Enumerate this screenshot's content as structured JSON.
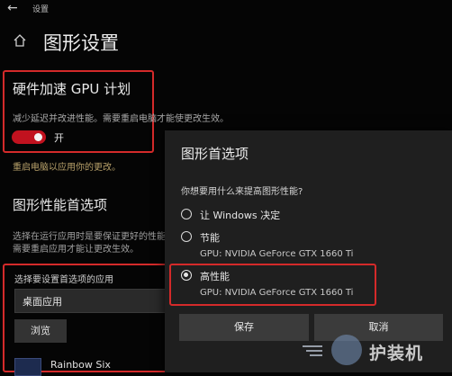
{
  "titlebar": {
    "back": "←",
    "title": "设置"
  },
  "header": {
    "title": "图形设置"
  },
  "hardware_gpu": {
    "title": "硬件加速 GPU 计划",
    "description": "减少延迟并改进性能。需要重启电脑才能使更改生效。",
    "toggle_label": "开",
    "toggle_on": true,
    "restart_note": "重启电脑以应用你的更改。"
  },
  "graphics_performance": {
    "title": "图形性能首选项",
    "desc_line1": "选择在运行应用时是要保证更好的性能还是节省电池电量。",
    "desc_line2": "需要重启应用才能让更改生效。",
    "choose_label": "选择要设置首选项的应用",
    "app_type_selected": "桌面应用",
    "browse_label": "浏览",
    "app_name": "Rainbow Six"
  },
  "dialog": {
    "title": "图形首选项",
    "question": "你想要用什么来提高图形性能?",
    "options": [
      {
        "label": "让 Windows 决定",
        "gpu": "",
        "selected": false
      },
      {
        "label": "节能",
        "gpu": "GPU: NVIDIA GeForce GTX 1660 Ti",
        "selected": false
      },
      {
        "label": "高性能",
        "gpu": "GPU: NVIDIA GeForce GTX 1660 Ti",
        "selected": true
      }
    ],
    "save_label": "保存",
    "cancel_label": "取消"
  },
  "watermark": {
    "text": "护装机"
  },
  "colors": {
    "accent": "#c1121f",
    "highlight_box": "#d42a2a",
    "background": "#050505",
    "dialog": "#1f1f1f"
  }
}
